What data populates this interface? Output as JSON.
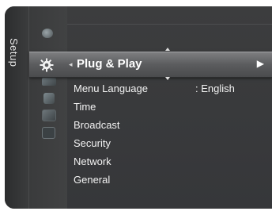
{
  "tab": {
    "label": "Setup"
  },
  "selected": {
    "label": "Plug & Play",
    "left_glyph": "◂",
    "right_glyph": "▶"
  },
  "menu": {
    "items": [
      {
        "label": "Menu Language",
        "value": ": English"
      },
      {
        "label": "Time",
        "value": ""
      },
      {
        "label": "Broadcast",
        "value": ""
      },
      {
        "label": "Security",
        "value": ""
      },
      {
        "label": "Network",
        "value": ""
      },
      {
        "label": "General",
        "value": ""
      }
    ]
  },
  "icons": {
    "picture": "picture-icon",
    "sound": "sound-icon",
    "channel": "channel-icon",
    "input": "input-icon",
    "support": "support-icon",
    "setup": "gear-icon"
  },
  "colors": {
    "panel": "#3a3b3c",
    "highlight": "#6e6f71",
    "text": "#f3f3f3"
  }
}
